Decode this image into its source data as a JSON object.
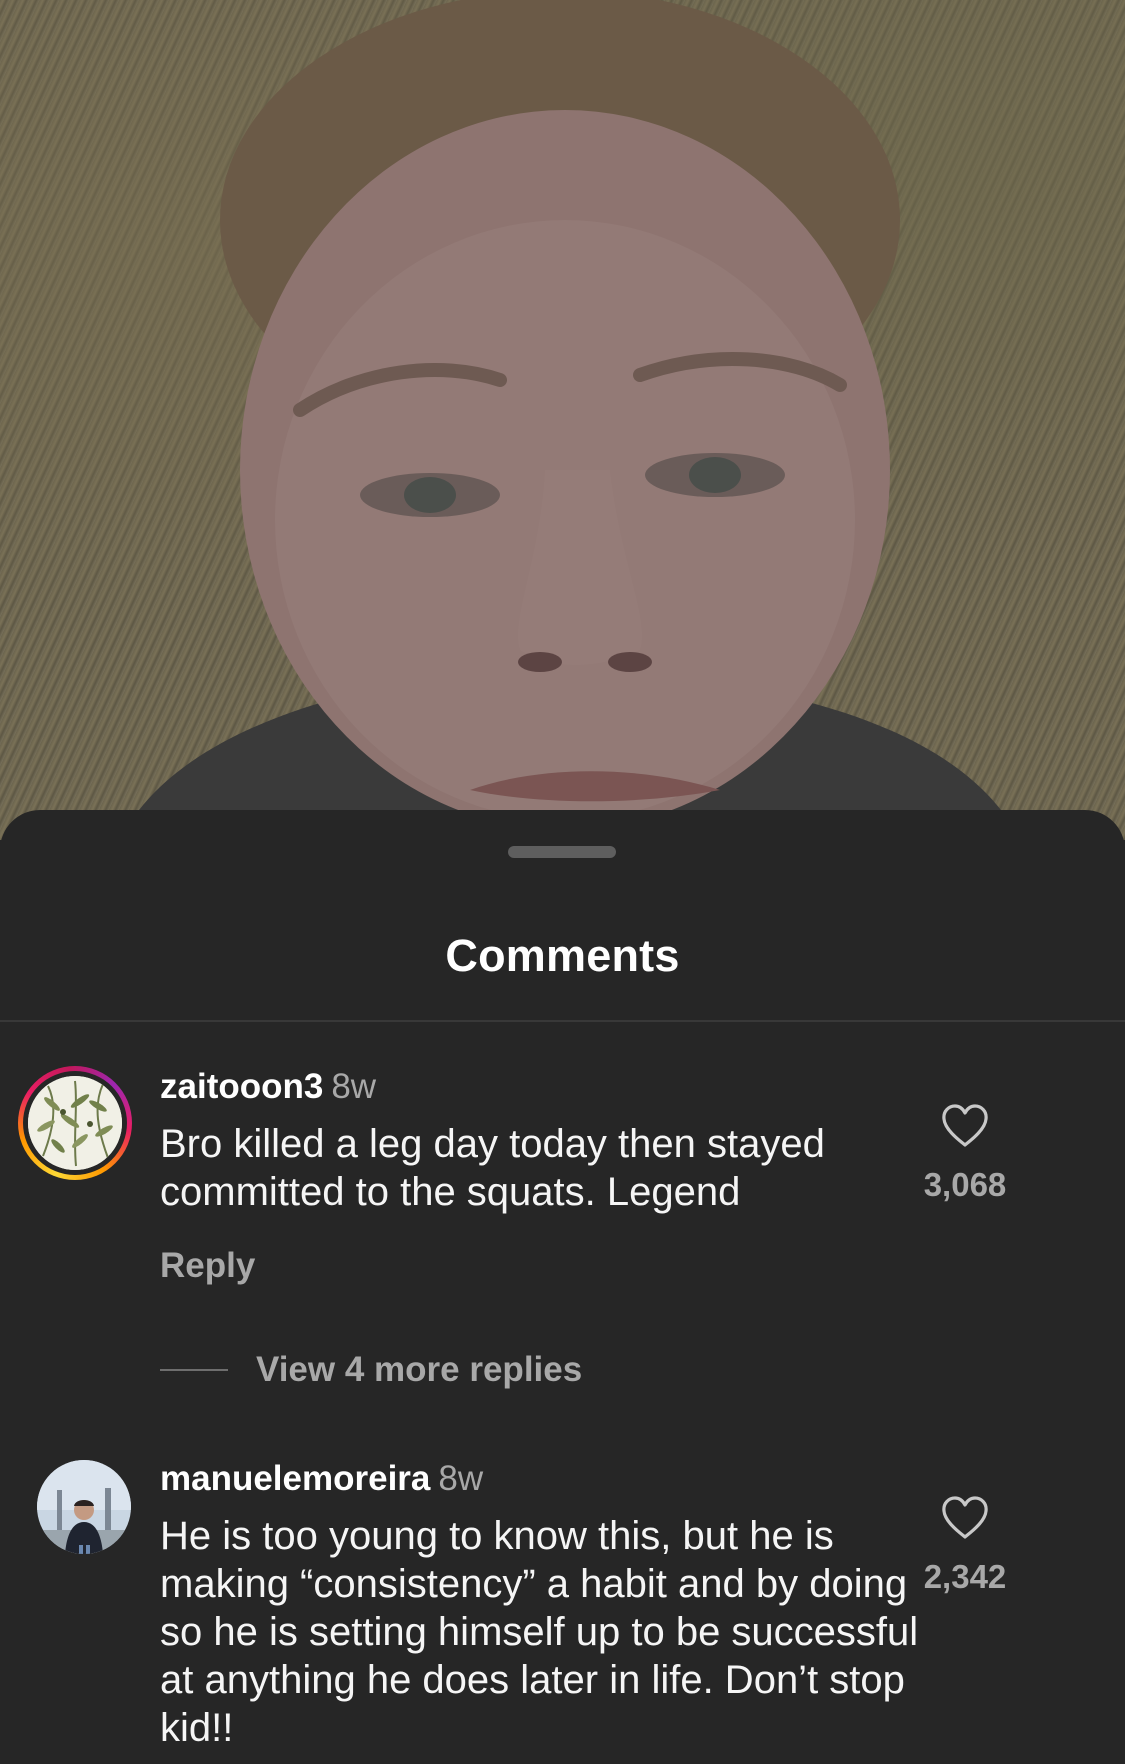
{
  "sheet": {
    "title": "Comments"
  },
  "comments": [
    {
      "username": "zaitooon3",
      "time": "8w",
      "text": "Bro killed a leg day today then stayed committed to the squats. Legend",
      "reply_label": "Reply",
      "like_count": "3,068",
      "has_story_ring": true,
      "avatar_icon": "olive-branch-avatar"
    },
    {
      "username": "manuelemoreira",
      "time": "8w",
      "text": "He is too young to know this, but he is making “consistency” a habit and by doing so he is setting himself up to be successful at anything he does later in life. Don’t stop kid!!",
      "like_count": "2,342",
      "has_story_ring": false,
      "avatar_icon": "person-photo-avatar"
    }
  ],
  "view_more_replies": "View 4 more replies",
  "icons": {
    "like": "heart-outline-icon",
    "grabber": "sheet-grabber-handle"
  },
  "colors": {
    "sheet_bg": "#262626",
    "text_primary": "#f5f5f5",
    "text_secondary": "#a8a8a8"
  }
}
